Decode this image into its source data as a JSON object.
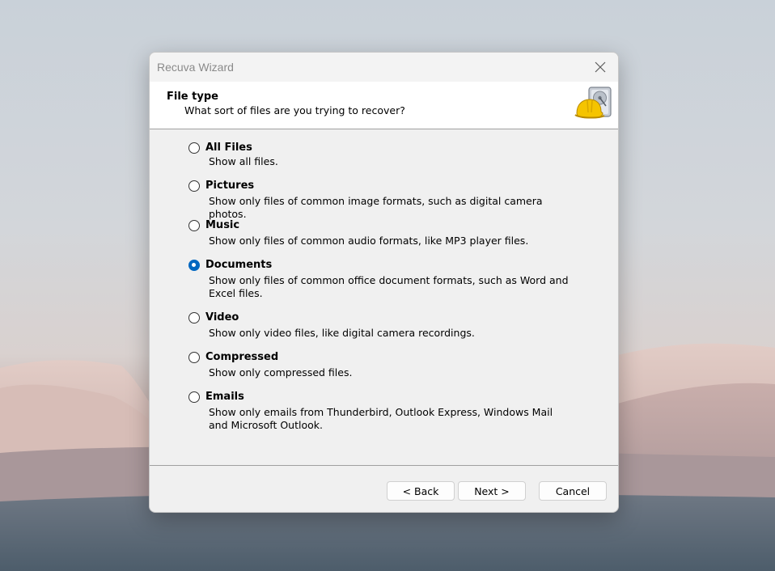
{
  "window": {
    "title": "Recuva Wizard",
    "header": {
      "title": "File type",
      "subtitle": "What sort of files are you trying to recover?",
      "icon": "recuva-hdd-hardhat-icon"
    },
    "selected": "Documents",
    "options": [
      {
        "label": "All Files",
        "description": "Show all files."
      },
      {
        "label": "Pictures",
        "description": "Show only files of common image formats, such as digital camera photos."
      },
      {
        "label": "Music",
        "description": "Show only files of common audio formats, like MP3 player files."
      },
      {
        "label": "Documents",
        "description": "Show only files of common office document formats, such as Word and Excel files."
      },
      {
        "label": "Video",
        "description": "Show only video files, like digital camera recordings."
      },
      {
        "label": "Compressed",
        "description": "Show only compressed files."
      },
      {
        "label": "Emails",
        "description": "Show only emails from Thunderbird, Outlook Express, Windows Mail and Microsoft Outlook."
      }
    ],
    "buttons": {
      "back": "< Back",
      "next": "Next >",
      "cancel": "Cancel"
    },
    "colors": {
      "accent": "#0067c0",
      "dialog_bg": "#f0f0f0"
    }
  }
}
